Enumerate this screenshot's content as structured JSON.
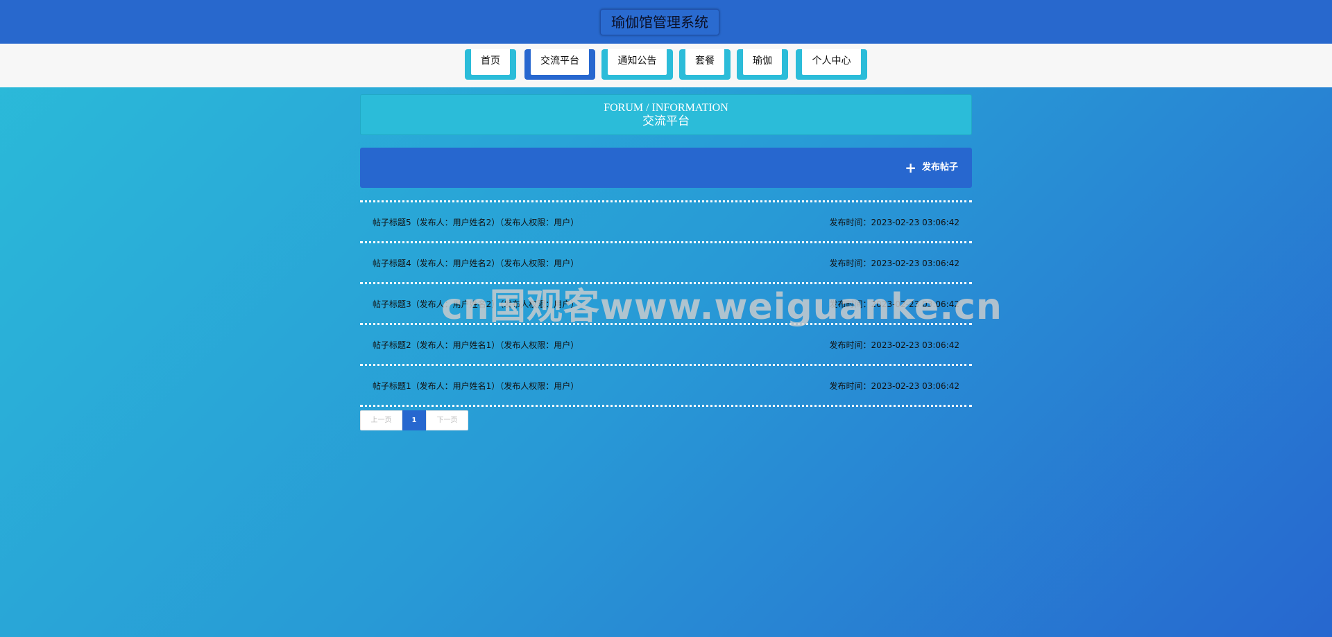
{
  "header": {
    "title": "瑜伽馆管理系统"
  },
  "nav": {
    "items": [
      {
        "label": "首页"
      },
      {
        "label": "交流平台"
      },
      {
        "label": "通知公告"
      },
      {
        "label": "套餐"
      },
      {
        "label": "瑜伽"
      },
      {
        "label": "个人中心"
      }
    ],
    "active": "交流平台"
  },
  "heading": {
    "en": "FORUM / INFORMATION",
    "cn": "交流平台"
  },
  "actions": {
    "post_label": "发布帖子",
    "icon": "plus-icon"
  },
  "posts": [
    {
      "title": "帖子标题5（发布人：用户姓名2）（发布人权限：用户）",
      "time": "发布时间：2023-02-23 03:06:42"
    },
    {
      "title": "帖子标题4（发布人：用户姓名2）（发布人权限：用户）",
      "time": "发布时间：2023-02-23 03:06:42"
    },
    {
      "title": "帖子标题3（发布人：用户姓名2）（发布人权限：用户）",
      "time": "发布时间：2023-02-23 03:06:42"
    },
    {
      "title": "帖子标题2（发布人：用户姓名1）（发布人权限：用户）",
      "time": "发布时间：2023-02-23 03:06:42"
    },
    {
      "title": "帖子标题1（发布人：用户姓名1）（发布人权限：用户）",
      "time": "发布时间：2023-02-23 03:06:42"
    }
  ],
  "pagination": {
    "prev": "上一页",
    "current": "1",
    "next": "下一页"
  },
  "watermark": "cn国观客www.weiguanke.cn",
  "colors": {
    "header_bg": "#2868cd",
    "accent_cyan": "#2bbcd9",
    "accent_blue": "#2767cf",
    "nav_bg": "#f7f7f7"
  }
}
